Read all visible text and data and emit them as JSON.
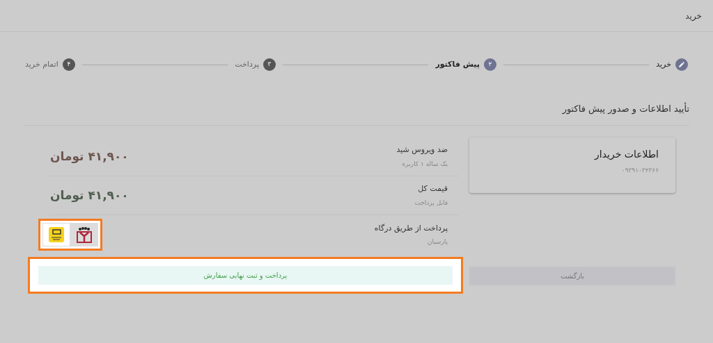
{
  "header": {
    "title": "خرید"
  },
  "steps": [
    {
      "kind": "edit",
      "label": "خرید",
      "selected": false
    },
    {
      "kind": "number",
      "number": "۲",
      "label": "پیش فاکتور",
      "selected": true
    },
    {
      "kind": "number",
      "number": "۳",
      "label": "پرداخت",
      "selected": false
    },
    {
      "kind": "number",
      "number": "۴",
      "label": "اتمام خرید",
      "selected": false
    }
  ],
  "section_title": "تأیید اطلاعات و صدور پیش فاکتور",
  "buyer": {
    "title": "اطلاعات خریدار",
    "phone": "۰۹۳۹۱۰۳۲۳۶۶"
  },
  "rows": [
    {
      "kind": "price",
      "title": "ضد ویروس شید",
      "subtitle": "یک ساله ۱ کاربره",
      "amount": "۴۱,۹۰۰ تومان",
      "color": "#6e5650"
    },
    {
      "kind": "price",
      "title": "قیمت کل",
      "subtitle": "قابل پرداخت",
      "amount": "۴۱,۹۰۰ تومان",
      "color": "#4f5e50"
    },
    {
      "kind": "gateway",
      "title": "پرداخت از طریق درگاه",
      "subtitle": "پارسیان",
      "gateways": [
        {
          "kind": "emblem",
          "selected": true
        },
        {
          "kind": "card",
          "selected": false
        }
      ]
    }
  ],
  "buttons": {
    "back": "بازگشت",
    "pay": "پرداخت و ثبت نهایی سفارش"
  }
}
